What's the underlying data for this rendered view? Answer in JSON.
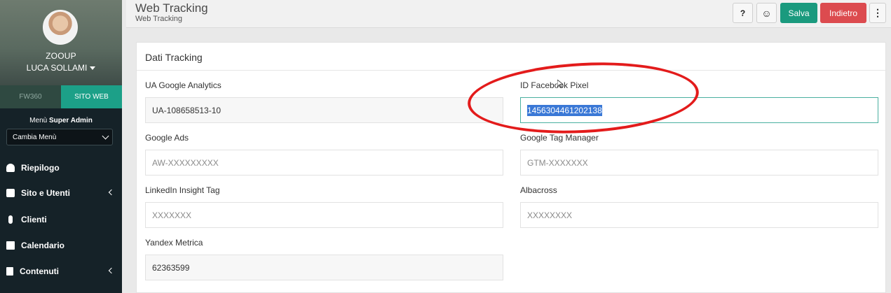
{
  "sidebar": {
    "org": "ZOOUP",
    "user_name": "LUCA SOLLAMI",
    "tabs": [
      "FW360",
      "SITO WEB"
    ],
    "menu_label_prefix": "Menù ",
    "menu_label_bold": "Super Admin",
    "menu_select": "Cambia Menù",
    "items": [
      {
        "label": "Riepilogo",
        "icon": "dashboard-icon"
      },
      {
        "label": "Sito e Utenti",
        "icon": "shop-icon"
      },
      {
        "label": "Clienti",
        "icon": "person-icon"
      },
      {
        "label": "Calendario",
        "icon": "calendar-icon"
      },
      {
        "label": "Contenuti",
        "icon": "file-icon"
      }
    ]
  },
  "header": {
    "title": "Web Tracking",
    "subtitle": "Web Tracking",
    "help_label": "?",
    "smile_label": "☺",
    "save_label": "Salva",
    "back_label": "Indietro",
    "more_label": "⋮"
  },
  "card": {
    "title": "Dati Tracking",
    "fields": {
      "ua": {
        "label": "UA Google Analytics",
        "value": "UA-108658513-10"
      },
      "fb": {
        "label": "ID Facebook Pixel",
        "value": "1456304461202138"
      },
      "ads": {
        "label": "Google Ads",
        "placeholder": "AW-XXXXXXXXX"
      },
      "gtm": {
        "label": "Google Tag Manager",
        "placeholder": "GTM-XXXXXXX"
      },
      "linkedin": {
        "label": "LinkedIn Insight Tag",
        "placeholder": "XXXXXXX"
      },
      "albacross": {
        "label": "Albacross",
        "placeholder": "XXXXXXXX"
      },
      "yandex": {
        "label": "Yandex Metrica",
        "value": "62363599"
      }
    }
  },
  "colors": {
    "accent": "#1a9a7e",
    "danger": "#dc4b4f",
    "annotation": "#e31b1b"
  }
}
